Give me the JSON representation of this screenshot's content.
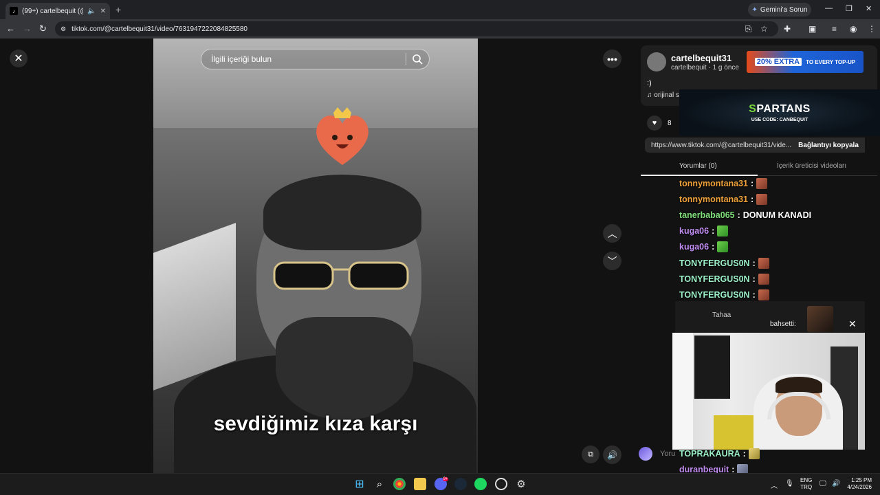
{
  "browser": {
    "tab_title": "(99+) cartelbequit (@cartelb",
    "new_tab": "+",
    "gemini_label": "Gemini'a Sorun",
    "url": "tiktok.com/@cartelbequit31/video/7631947222084825580"
  },
  "video": {
    "search_placeholder": "İlgili içeriği bulun",
    "subtitle": "sevdiğimiz kıza karşı"
  },
  "info": {
    "username": "cartelbequit31",
    "nick_meta": "cartelbequit · 1 g önce",
    "caption": ":)",
    "music": "♫  orijinal s",
    "like_count": "8",
    "link_url": "https://www.tiktok.com/@cartelbequit31/vide...",
    "copy_link": "Bağlantıyı kopyala",
    "tab_comments": "Yorumlar (0)",
    "tab_creator": "İçerik üreticisi videoları",
    "comment_placeholder": "Yoru"
  },
  "ads": {
    "ad1_big": "20% EXTRA",
    "ad1_small": "TO EVERY TOP-UP",
    "ad2_title_s": "S",
    "ad2_title": "PARTANS",
    "ad2_code": "USE CODE: CANBEQUIT"
  },
  "chat": [
    {
      "user": "tonnymontana31",
      "color": "#f0a23a",
      "msg": "",
      "emote": "red"
    },
    {
      "user": "tonnymontana31",
      "color": "#f0a23a",
      "msg": "",
      "emote": "red"
    },
    {
      "user": "tanerbaba065",
      "color": "#7fe07a",
      "msg": "DONUM KANADI",
      "emote": ""
    },
    {
      "user": "kuga06",
      "color": "#c08cf0",
      "msg": "",
      "emote": "green"
    },
    {
      "user": "kuga06",
      "color": "#c08cf0",
      "msg": "",
      "emote": "green"
    },
    {
      "user": "TONYFERGUS0N",
      "color": "#9cf0c8",
      "msg": "",
      "emote": "red"
    },
    {
      "user": "TONYFERGUS0N",
      "color": "#9cf0c8",
      "msg": "",
      "emote": "red"
    },
    {
      "user": "TONYFERGUS0N",
      "color": "#9cf0c8",
      "msg": "",
      "emote": "red"
    },
    {
      "user": "TONYFERGUS0N",
      "color": "#9cf0c8",
      "msg": "",
      "emote": "red"
    },
    {
      "user": "TONYFERGUS0N",
      "color": "#9cf0c8",
      "msg": "",
      "emote": "red"
    }
  ],
  "chat_bottom": [
    {
      "user": "TOPRAKAURA",
      "color": "#9cf0c8",
      "msg": "",
      "emote": "yellow"
    },
    {
      "user": "duranbequit",
      "color": "#c08cf0",
      "msg": "",
      "emote": "grey"
    },
    {
      "user": "kuga06",
      "color": "#c08cf0",
      "msg": "",
      "emote": "green"
    }
  ],
  "notification": {
    "name": "Tahaa",
    "text": "bahsetti:"
  },
  "taskbar": {
    "lang_top": "ENG",
    "lang_bottom": "TRQ",
    "time": "1:25 PM",
    "date": "4/24/2026",
    "discord_badge": "9+"
  }
}
